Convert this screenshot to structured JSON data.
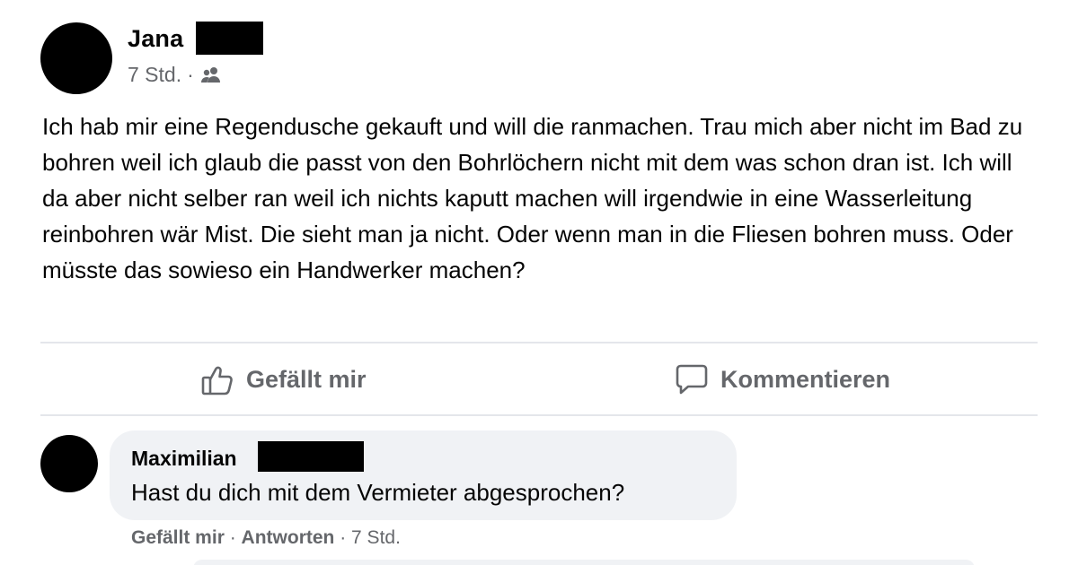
{
  "post": {
    "author": "Jana",
    "time": "7 Std.",
    "separator": "·",
    "audience_icon": "friends-icon",
    "text": "Ich hab mir eine Regendusche gekauft und will die ranmachen. Trau mich aber nicht im Bad zu bohren weil ich glaub die passt von den Bohrlöchern nicht mit dem was schon dran ist. Ich will da aber nicht selber ran weil ich nichts kaputt machen will irgendwie in eine Wasserleitung reinbohren wär Mist. Die sieht man ja nicht. Oder wenn man in die Fliesen bohren muss. Oder müsste das sowieso ein Handwerker machen?"
  },
  "actions": {
    "like_label": "Gefällt mir",
    "like_icon": "thumbs-up-icon",
    "comment_label": "Kommentieren",
    "comment_icon": "speech-bubble-icon"
  },
  "comment": {
    "author": "Maximilian",
    "text": "Hast du dich mit dem Vermieter abgesprochen?",
    "like_label": "Gefällt mir",
    "separator": " · ",
    "reply_label": "Antworten",
    "time": "7 Std."
  },
  "colors": {
    "text_primary": "#050505",
    "text_secondary": "#65676b",
    "bubble_bg": "#f0f2f5",
    "divider": "#e4e6eb"
  }
}
